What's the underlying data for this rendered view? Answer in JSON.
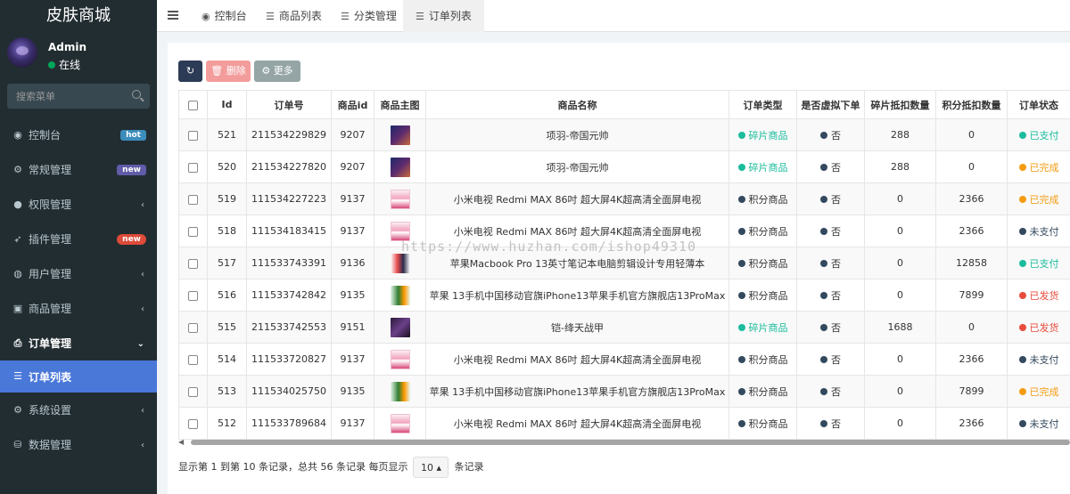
{
  "app": {
    "title": "皮肤商城",
    "user_name": "Admin",
    "user_status": "在线",
    "search_placeholder": "搜索菜单"
  },
  "menu": {
    "items": [
      {
        "label": "控制台",
        "icon": "dashboard-icon",
        "badge": "hot"
      },
      {
        "label": "常规管理",
        "icon": "cogs-icon",
        "badge": "new"
      },
      {
        "label": "权限管理",
        "icon": "users-icon"
      },
      {
        "label": "插件管理",
        "icon": "rocket-icon",
        "badge": "new"
      },
      {
        "label": "用户管理",
        "icon": "user-circle-icon"
      },
      {
        "label": "商品管理",
        "icon": "shop-icon"
      },
      {
        "label": "订单管理",
        "icon": "print-icon"
      },
      {
        "label": "订单列表",
        "icon": "list-icon"
      },
      {
        "label": "系统设置",
        "icon": "gear-icon"
      },
      {
        "label": "数据管理",
        "icon": "database-icon"
      }
    ]
  },
  "tabs": [
    {
      "label": "控制台",
      "icon": "dashboard-icon"
    },
    {
      "label": "商品列表",
      "icon": "list-icon"
    },
    {
      "label": "分类管理",
      "icon": "list-icon"
    },
    {
      "label": "订单列表",
      "icon": "list-icon"
    }
  ],
  "toolbar": {
    "delete_label": "删除",
    "more_label": "更多"
  },
  "table": {
    "headers": [
      "Id",
      "订单号",
      "商品id",
      "商品主图",
      "商品名称",
      "订单类型",
      "是否虚拟下单",
      "碎片抵扣数量",
      "积分抵扣数量",
      "订单状态"
    ],
    "rows": [
      {
        "id": "521",
        "order_no": "211534229829",
        "goods_id": "9207",
        "thumb": "hero",
        "name": "项羽-帝国元帅",
        "type": "碎片商品",
        "type_color": "#1abc9c",
        "virtual": "否",
        "frag": "288",
        "points": "0",
        "status": "已支付",
        "status_color": "#1abc9c"
      },
      {
        "id": "520",
        "order_no": "211534227820",
        "goods_id": "9207",
        "thumb": "hero",
        "name": "项羽-帝国元帅",
        "type": "碎片商品",
        "type_color": "#1abc9c",
        "virtual": "否",
        "frag": "288",
        "points": "0",
        "status": "已完成",
        "status_color": "#f39c12"
      },
      {
        "id": "519",
        "order_no": "111534227223",
        "goods_id": "9137",
        "thumb": "tv",
        "name": "小米电视 Redmi MAX 86吋 超大屏4K超高清全面屏电视",
        "type": "积分商品",
        "type_color": "#34495e",
        "virtual": "否",
        "frag": "0",
        "points": "2366",
        "status": "已完成",
        "status_color": "#f39c12"
      },
      {
        "id": "518",
        "order_no": "111534183415",
        "goods_id": "9137",
        "thumb": "tv",
        "name": "小米电视 Redmi MAX 86吋 超大屏4K超高清全面屏电视",
        "type": "积分商品",
        "type_color": "#34495e",
        "virtual": "否",
        "frag": "0",
        "points": "2366",
        "status": "未支付",
        "status_color": "#34495e"
      },
      {
        "id": "517",
        "order_no": "111533743391",
        "goods_id": "9136",
        "thumb": "mac",
        "name": "苹果Macbook Pro 13英寸笔记本电脑剪辑设计专用轻薄本",
        "type": "积分商品",
        "type_color": "#34495e",
        "virtual": "否",
        "frag": "0",
        "points": "12858",
        "status": "已支付",
        "status_color": "#1abc9c"
      },
      {
        "id": "516",
        "order_no": "111533742842",
        "goods_id": "9135",
        "thumb": "phone",
        "name": "苹果 13手机中国移动官旗iPhone13苹果手机官方旗舰店13ProMax",
        "type": "积分商品",
        "type_color": "#34495e",
        "virtual": "否",
        "frag": "0",
        "points": "7899",
        "status": "已发货",
        "status_color": "#e74c3c"
      },
      {
        "id": "515",
        "order_no": "211533742553",
        "goods_id": "9151",
        "thumb": "armor",
        "name": "铠-绛天战甲",
        "type": "碎片商品",
        "type_color": "#1abc9c",
        "virtual": "否",
        "frag": "1688",
        "points": "0",
        "status": "已发货",
        "status_color": "#e74c3c"
      },
      {
        "id": "514",
        "order_no": "111533720827",
        "goods_id": "9137",
        "thumb": "tv",
        "name": "小米电视 Redmi MAX 86吋 超大屏4K超高清全面屏电视",
        "type": "积分商品",
        "type_color": "#34495e",
        "virtual": "否",
        "frag": "0",
        "points": "2366",
        "status": "未支付",
        "status_color": "#34495e"
      },
      {
        "id": "513",
        "order_no": "111534025750",
        "goods_id": "9135",
        "thumb": "phone",
        "name": "苹果 13手机中国移动官旗iPhone13苹果手机官方旗舰店13ProMax",
        "type": "积分商品",
        "type_color": "#34495e",
        "virtual": "否",
        "frag": "0",
        "points": "7899",
        "status": "已完成",
        "status_color": "#f39c12"
      },
      {
        "id": "512",
        "order_no": "111533789684",
        "goods_id": "9137",
        "thumb": "tv",
        "name": "小米电视 Redmi MAX 86吋 超大屏4K超高清全面屏电视",
        "type": "积分商品",
        "type_color": "#34495e",
        "virtual": "否",
        "frag": "0",
        "points": "2366",
        "status": "未支付",
        "status_color": "#34495e"
      }
    ]
  },
  "pagination": {
    "summary": "显示第 1 到第 10 条记录，总共 56 条记录 每页显示",
    "page_size": "10",
    "suffix": "条记录"
  },
  "watermark": "https://www.huzhan.com/ishop49310"
}
